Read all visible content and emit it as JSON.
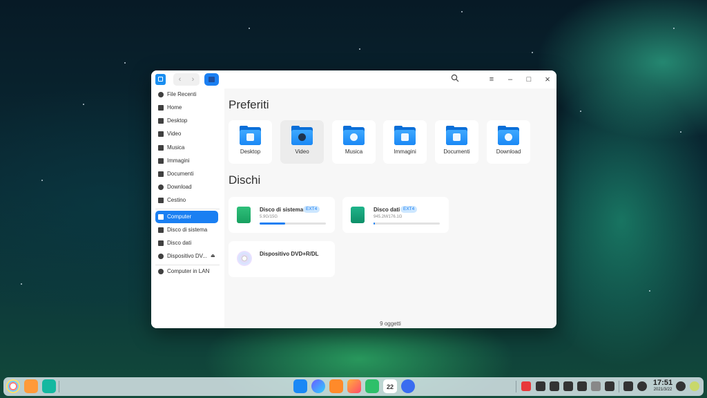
{
  "titlebar": {
    "back": "‹",
    "forward": "›",
    "search_icon": "search-icon",
    "menu_glyph": "≡",
    "minimize_glyph": "–",
    "maximize_glyph": "□",
    "close_glyph": "×"
  },
  "sidebar": {
    "items": [
      {
        "label": "File Recenti",
        "icon": "clock-icon"
      },
      {
        "label": "Home",
        "icon": "home-icon"
      },
      {
        "label": "Desktop",
        "icon": "desktop-icon"
      },
      {
        "label": "Video",
        "icon": "video-icon"
      },
      {
        "label": "Musica",
        "icon": "music-icon"
      },
      {
        "label": "Immagini",
        "icon": "image-icon"
      },
      {
        "label": "Documenti",
        "icon": "document-icon"
      },
      {
        "label": "Download",
        "icon": "download-icon"
      },
      {
        "label": "Cestino",
        "icon": "trash-icon"
      },
      {
        "label": "Computer",
        "icon": "computer-icon",
        "active": true
      },
      {
        "label": "Disco di sistema",
        "icon": "disk-icon"
      },
      {
        "label": "Disco dati",
        "icon": "disk-icon"
      },
      {
        "label": "Dispositivo DV...",
        "icon": "dvd-icon",
        "eject": "⏏"
      },
      {
        "label": "Computer in LAN",
        "icon": "network-icon"
      }
    ]
  },
  "main": {
    "favorites_title": "Preferiti",
    "favorites": [
      {
        "label": "Desktop"
      },
      {
        "label": "Video"
      },
      {
        "label": "Musica"
      },
      {
        "label": "Immagini"
      },
      {
        "label": "Documenti"
      },
      {
        "label": "Download"
      }
    ],
    "disks_title": "Dischi",
    "disks": [
      {
        "name": "Disco di sistema",
        "fs": "EXT4",
        "size": "5.9G/15G",
        "usage_fraction": 0.39
      },
      {
        "name": "Disco dati",
        "fs": "EXT4",
        "size": "945.2M/176.1G",
        "usage_fraction": 0.01
      },
      {
        "name": "Dispositivo DVD+R/DL"
      }
    ],
    "status": "9 oggetti"
  },
  "dock": {
    "time": "17:51",
    "date": "2021/3/22",
    "calendar_day": "22"
  },
  "colors": {
    "accent": "#1a7ff2",
    "folder": "#3fa9ff"
  }
}
